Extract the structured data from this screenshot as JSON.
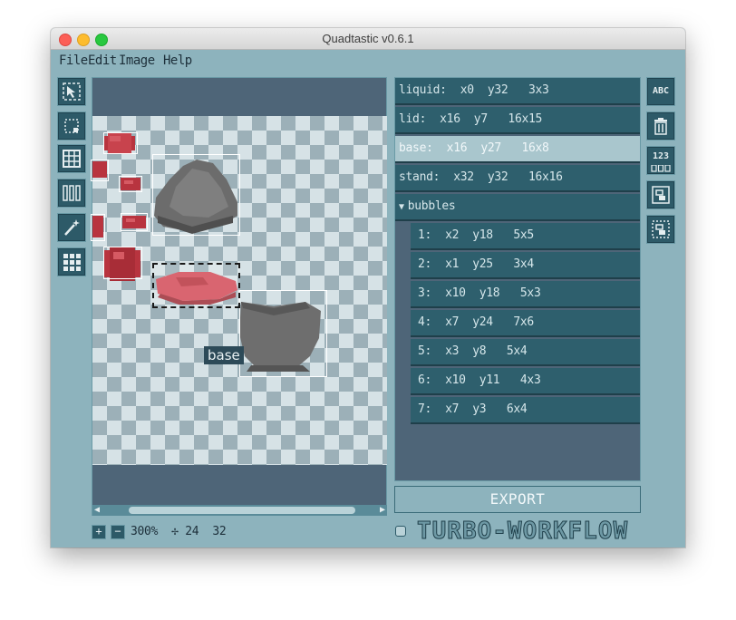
{
  "window": {
    "title": "Quadtastic v0.6.1"
  },
  "menu": [
    "File",
    "Edit",
    "Image",
    "Help"
  ],
  "tools": [
    {
      "name": "select",
      "icon": "cursor-select-icon"
    },
    {
      "name": "create",
      "icon": "create-rect-icon"
    },
    {
      "name": "grid",
      "icon": "grid-icon"
    },
    {
      "name": "strips",
      "icon": "columns-icon"
    },
    {
      "name": "wand",
      "icon": "magic-wand-icon"
    },
    {
      "name": "tiles",
      "icon": "tile-grid-icon"
    }
  ],
  "canvas": {
    "selected_quad_tooltip": "base"
  },
  "status": {
    "zoom_in": "+",
    "zoom_out": "−",
    "text": "300%  ✢ 24  32"
  },
  "quads": [
    {
      "label": "liquid:  x0  y32   3x3",
      "selected": false,
      "child": false
    },
    {
      "label": "lid:  x16  y7   16x15",
      "selected": false,
      "child": false
    },
    {
      "label": "base:  x16  y27   16x8",
      "selected": true,
      "child": false
    },
    {
      "label": "stand:  x32  y32   16x16",
      "selected": false,
      "child": false
    },
    {
      "label": "bubbles",
      "selected": false,
      "child": false,
      "group": true
    },
    {
      "label": "1:  x2  y18   5x5",
      "selected": false,
      "child": true
    },
    {
      "label": "2:  x1  y25   3x4",
      "selected": false,
      "child": true
    },
    {
      "label": "3:  x10  y18   5x3",
      "selected": false,
      "child": true
    },
    {
      "label": "4:  x7  y24   7x6",
      "selected": false,
      "child": true
    },
    {
      "label": "5:  x3  y8   5x4",
      "selected": false,
      "child": true
    },
    {
      "label": "6:  x10  y11   4x3",
      "selected": false,
      "child": true
    },
    {
      "label": "7:  x7  y3   6x4",
      "selected": false,
      "child": true
    }
  ],
  "export_label": "EXPORT",
  "turbo_workflow_label": "TURBO-WORKFLOW",
  "right_tools": [
    {
      "name": "rename",
      "icon": "rename-icon",
      "text": "ABC"
    },
    {
      "name": "delete",
      "icon": "trash-icon"
    },
    {
      "name": "sort",
      "icon": "sort-numbers-icon",
      "text": "123"
    },
    {
      "name": "group",
      "icon": "group-icon"
    },
    {
      "name": "ungroup",
      "icon": "ungroup-icon"
    }
  ],
  "colors": {
    "window_bg": "#8db3bd",
    "panel_dark": "#2e5f6d",
    "selected_row": "#a9c6cd",
    "accent_red": "#c8434d"
  }
}
